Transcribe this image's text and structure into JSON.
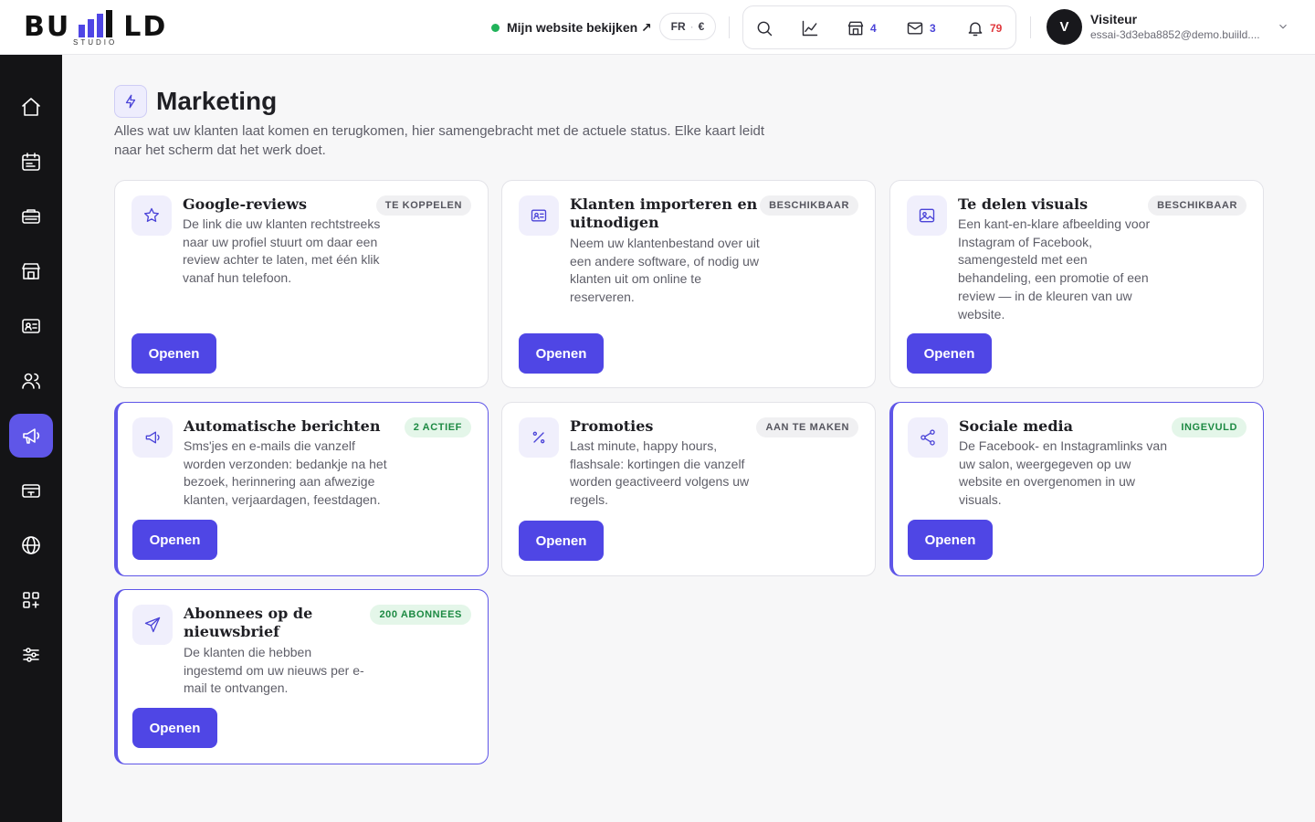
{
  "brand": {
    "logo_text": "BUILD",
    "logo_sub": "STUDIO",
    "bar_color": "#4f46e5"
  },
  "header": {
    "site_link": "Mijn website bekijken ↗",
    "lang": "FR",
    "currency": "€",
    "icons": [
      {
        "name": "search-icon",
        "count": ""
      },
      {
        "name": "chart-icon",
        "count": ""
      },
      {
        "name": "store-icon",
        "count": "4"
      },
      {
        "name": "mail-icon",
        "count": "3"
      },
      {
        "name": "bell-icon",
        "count": "79"
      }
    ],
    "user": {
      "initial": "V",
      "name": "Visiteur",
      "email": "essai-3d3eba8852@demo.buiild...."
    }
  },
  "sidebar": {
    "items": [
      {
        "icon": "home-icon",
        "active": false
      },
      {
        "icon": "calendar-icon",
        "active": false
      },
      {
        "icon": "services-icon",
        "active": false
      },
      {
        "icon": "shop-icon",
        "active": false
      },
      {
        "icon": "contact-card-icon",
        "active": false
      },
      {
        "icon": "users-icon",
        "active": false
      },
      {
        "icon": "megaphone-icon",
        "active": true
      },
      {
        "icon": "payment-card-icon",
        "active": false
      },
      {
        "icon": "globe-icon",
        "active": false
      },
      {
        "icon": "apps-icon",
        "active": false
      },
      {
        "icon": "sliders-icon",
        "active": false
      }
    ]
  },
  "page": {
    "title": "Marketing",
    "description": "Alles wat uw klanten laat komen en terugkomen, hier samengebracht met de actuele status. Elke kaart leidt naar het scherm dat het werk doet."
  },
  "colors": {
    "accent": "#4f46e5",
    "sidebar_bg": "#141416",
    "badge_green": "#1d8a43"
  },
  "cards": [
    {
      "title": "Google-reviews",
      "badge": "TE KOPPELEN",
      "badge_style": "grey",
      "icon": "star-icon",
      "description": "De link die uw klanten rechtstreeks naar uw profiel stuurt om daar een review achter te laten, met één klik vanaf hun telefoon.",
      "button": "Openen"
    },
    {
      "title": "Klanten importeren en uitnodigen",
      "badge": "BESCHIKBAAR",
      "badge_style": "grey",
      "icon": "id-card-icon",
      "description": "Neem uw klantenbestand over uit een andere software, of nodig uw klanten uit om online te reserveren.",
      "button": "Openen"
    },
    {
      "title": "Te delen visuals",
      "badge": "BESCHIKBAAR",
      "badge_style": "grey",
      "icon": "image-icon",
      "description": "Een kant-en-klare afbeelding voor Instagram of Facebook, samengesteld met een behandeling, een promotie of een review — in de kleuren van uw website.",
      "button": "Openen"
    },
    {
      "title": "Automatische berichten",
      "badge": "2 ACTIEF",
      "badge_style": "green",
      "icon": "megaphone-icon",
      "description": "Sms'jes en e-mails die vanzelf worden verzonden: bedankje na het bezoek, herinnering aan afwezige klanten, verjaardagen, feestdagen.",
      "button": "Openen"
    },
    {
      "title": "Promoties",
      "badge": "AAN TE MAKEN",
      "badge_style": "grey",
      "icon": "percent-icon",
      "description": "Last minute, happy hours, flashsale: kortingen die vanzelf worden geactiveerd volgens uw regels.",
      "button": "Openen"
    },
    {
      "title": "Sociale media",
      "badge": "INGEVULD",
      "badge_style": "green",
      "icon": "share-icon",
      "description": "De Facebook- en Instagramlinks van uw salon, weergegeven op uw website en overgenomen in uw visuals.",
      "button": "Openen"
    },
    {
      "title": "Abonnees op de nieuwsbrief",
      "badge": "200 ABONNEES",
      "badge_style": "green",
      "icon": "send-icon",
      "description": "De klanten die hebben ingestemd om uw nieuws per e-mail te ontvangen.",
      "button": "Openen"
    }
  ]
}
